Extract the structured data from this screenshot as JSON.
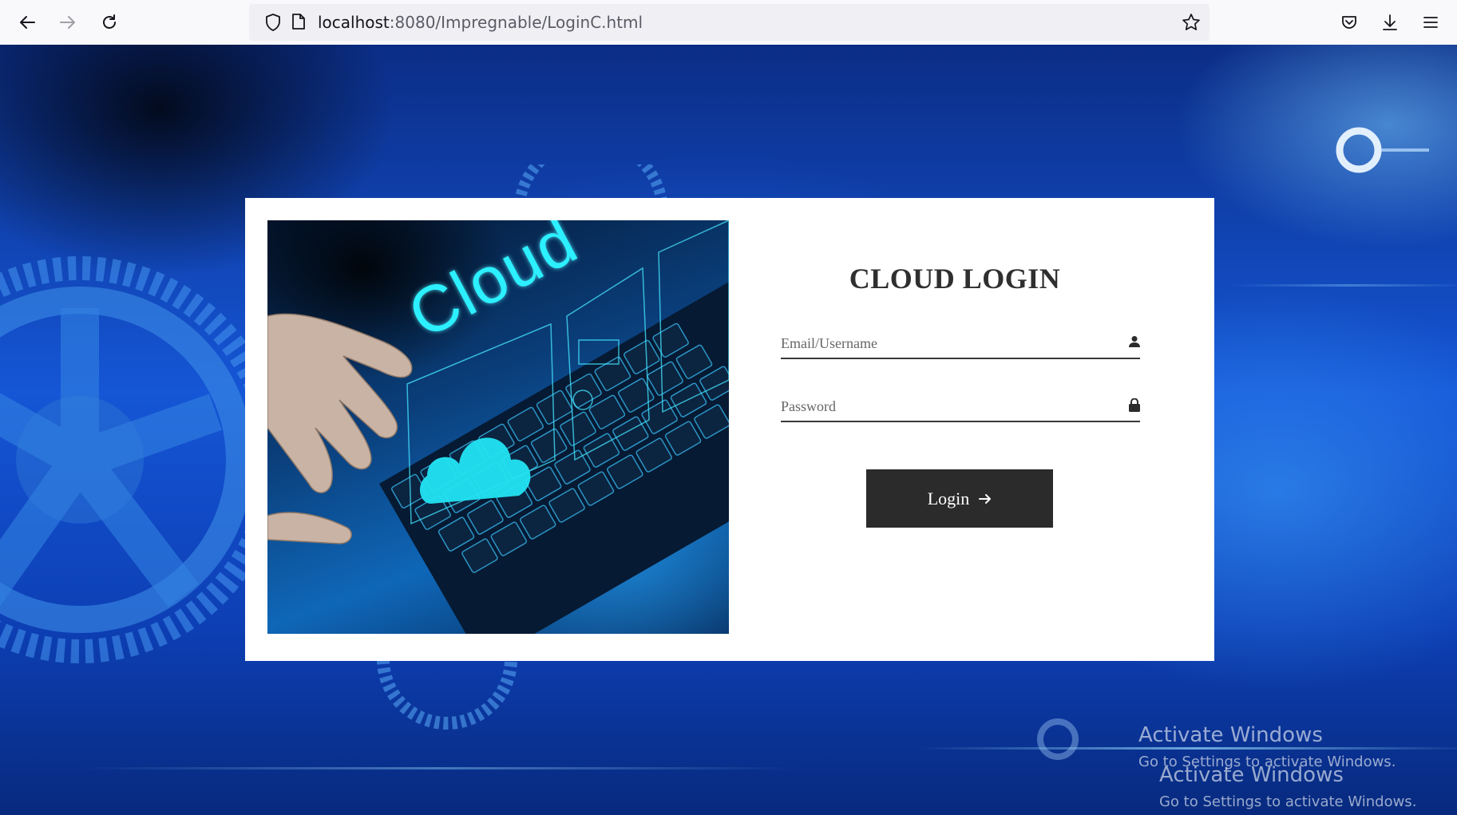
{
  "browser": {
    "url_host": "localhost",
    "url_path": ":8080/Impregnable/LoginC.html",
    "icons": [
      "back-arrow-icon",
      "forward-arrow-icon",
      "reload-icon",
      "shield-icon",
      "page-icon",
      "star-icon",
      "pocket-icon",
      "download-icon",
      "menu-icon"
    ]
  },
  "hero": {
    "word": "Cloud"
  },
  "login": {
    "title": "CLOUD LOGIN",
    "username_placeholder": "Email/Username",
    "password_placeholder": "Password",
    "button_label": "Login"
  },
  "watermark": {
    "title": "Activate Windows",
    "subtitle": "Go to Settings to activate Windows."
  },
  "colors": {
    "button_bg": "#2b2b2b",
    "accent_cyan": "#2cf0ff",
    "bg_blue": "#1556d6"
  }
}
